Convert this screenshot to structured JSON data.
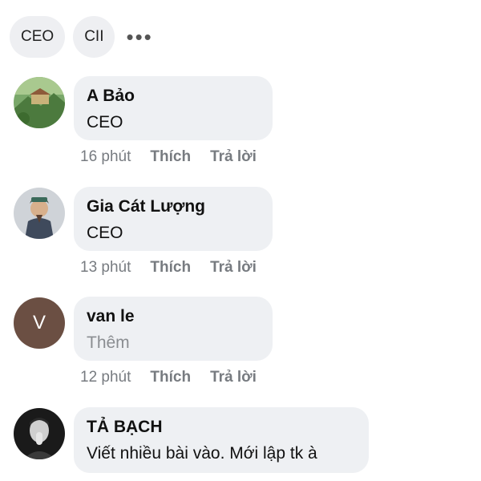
{
  "chips": [
    {
      "label": "CEO"
    },
    {
      "label": "CII"
    }
  ],
  "more_label": "•••",
  "comments": [
    {
      "author": "A Bảo",
      "text": "CEO",
      "time": "16 phút",
      "like": "Thích",
      "reply": "Trả lời",
      "avatar": "landscape-photo"
    },
    {
      "author": "Gia Cát Lượng",
      "text": "CEO",
      "time": "13 phút",
      "like": "Thích",
      "reply": "Trả lời",
      "avatar": "warrior-portrait"
    },
    {
      "author": "van le",
      "text": "Thêm",
      "time": "12 phút",
      "like": "Thích",
      "reply": "Trả lời",
      "avatar_letter": "V",
      "avatar_color": "#6b4f43"
    },
    {
      "author": "TẢ BẠCH",
      "text": "Viết nhiều bài vào. Mới lập tk à",
      "avatar": "man-portrait"
    }
  ]
}
